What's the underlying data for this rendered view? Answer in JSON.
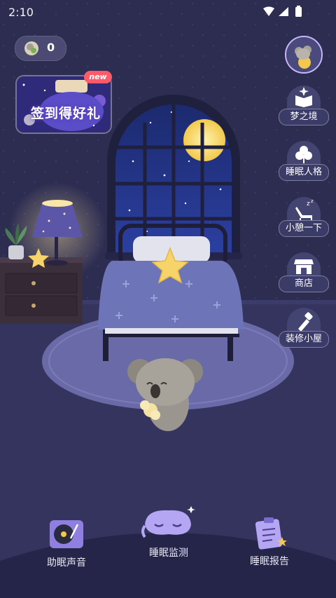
{
  "status_bar": {
    "time": "2:10"
  },
  "coins": {
    "count": "0"
  },
  "promo": {
    "badge": "new",
    "text": "签到得好礼"
  },
  "side_menu": {
    "items": [
      {
        "label": "梦之境"
      },
      {
        "label": "睡眠人格"
      },
      {
        "label": "小憩一下"
      },
      {
        "label": "商店"
      },
      {
        "label": "装修小屋"
      }
    ]
  },
  "bottom_nav": {
    "items": [
      {
        "label": "助眠声音"
      },
      {
        "label": "睡眠监测"
      },
      {
        "label": "睡眠报告"
      }
    ]
  }
}
